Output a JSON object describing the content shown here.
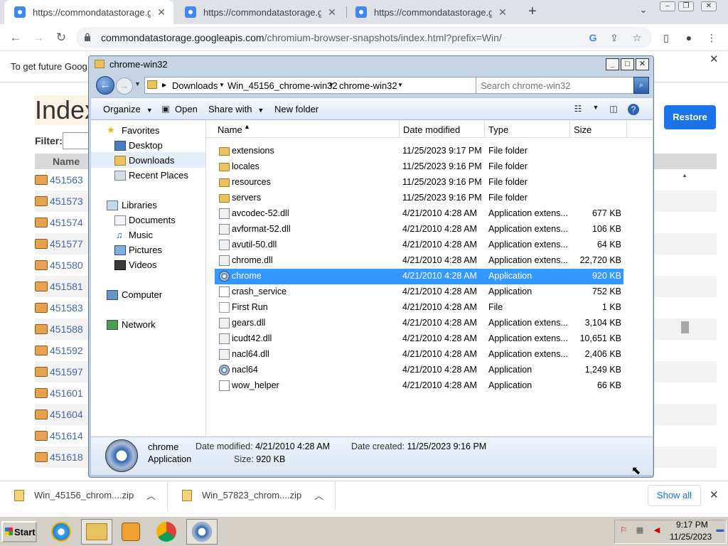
{
  "browser": {
    "tabs": [
      {
        "title": "https://commondatastorage.goo",
        "active": true
      },
      {
        "title": "https://commondatastorage.goo",
        "active": false
      },
      {
        "title": "https://commondatastorage.goo",
        "active": false
      }
    ],
    "new_tab_glyph": "+",
    "tab_close_glyph": "✕",
    "url_host": "commondatastorage.googleapis.com",
    "url_path": "/chromium-browser-snapshots/index.html?prefix=Win/"
  },
  "page": {
    "banner_text": "To get future Goog",
    "restore_label": "Restore",
    "index_title": "Index",
    "filter_label": "Filter:",
    "name_header": "Name",
    "rows": [
      "451563",
      "451573",
      "451574",
      "451577",
      "451580",
      "451581",
      "451583",
      "451588",
      "451592",
      "451597",
      "451601",
      "451604",
      "451614",
      "451618"
    ]
  },
  "explorer": {
    "title": "chrome-win32",
    "breadcrumb": [
      "Downloads",
      "Win_45156_chrome-win32",
      "chrome-win32"
    ],
    "search_placeholder": "Search chrome-win32",
    "commands": {
      "organize": "Organize",
      "open": "Open",
      "share_with": "Share with",
      "new_folder": "New folder"
    },
    "nav": {
      "favorites": "Favorites",
      "desktop": "Desktop",
      "downloads": "Downloads",
      "recent_places": "Recent Places",
      "libraries": "Libraries",
      "documents": "Documents",
      "music": "Music",
      "pictures": "Pictures",
      "videos": "Videos",
      "computer": "Computer",
      "network": "Network"
    },
    "columns": {
      "name": "Name",
      "date_modified": "Date modified",
      "type": "Type",
      "size": "Size"
    },
    "files": [
      {
        "name": "extensions",
        "date": "11/25/2023 9:17 PM",
        "type": "File folder",
        "size": "",
        "icon": "folder-icon"
      },
      {
        "name": "locales",
        "date": "11/25/2023 9:16 PM",
        "type": "File folder",
        "size": "",
        "icon": "folder-icon"
      },
      {
        "name": "resources",
        "date": "11/25/2023 9:16 PM",
        "type": "File folder",
        "size": "",
        "icon": "folder-icon"
      },
      {
        "name": "servers",
        "date": "11/25/2023 9:16 PM",
        "type": "File folder",
        "size": "",
        "icon": "folder-icon"
      },
      {
        "name": "avcodec-52.dll",
        "date": "4/21/2010 4:28 AM",
        "type": "Application extens...",
        "size": "677 KB",
        "icon": "dll-icon"
      },
      {
        "name": "avformat-52.dll",
        "date": "4/21/2010 4:28 AM",
        "type": "Application extens...",
        "size": "106 KB",
        "icon": "dll-icon"
      },
      {
        "name": "avutil-50.dll",
        "date": "4/21/2010 4:28 AM",
        "type": "Application extens...",
        "size": "64 KB",
        "icon": "dll-icon"
      },
      {
        "name": "chrome.dll",
        "date": "4/21/2010 4:28 AM",
        "type": "Application extens...",
        "size": "22,720 KB",
        "icon": "dll-icon"
      },
      {
        "name": "chrome",
        "date": "4/21/2010 4:28 AM",
        "type": "Application",
        "size": "920 KB",
        "icon": "chrome-app-icon",
        "selected": true
      },
      {
        "name": "crash_service",
        "date": "4/21/2010 4:28 AM",
        "type": "Application",
        "size": "752 KB",
        "icon": "exe-icon"
      },
      {
        "name": "First Run",
        "date": "4/21/2010 4:28 AM",
        "type": "File",
        "size": "1 KB",
        "icon": "file-icon"
      },
      {
        "name": "gears.dll",
        "date": "4/21/2010 4:28 AM",
        "type": "Application extens...",
        "size": "3,104 KB",
        "icon": "dll-icon"
      },
      {
        "name": "icudt42.dll",
        "date": "4/21/2010 4:28 AM",
        "type": "Application extens...",
        "size": "10,651 KB",
        "icon": "dll-icon"
      },
      {
        "name": "nacl64.dll",
        "date": "4/21/2010 4:28 AM",
        "type": "Application extens...",
        "size": "2,406 KB",
        "icon": "dll-icon"
      },
      {
        "name": "nacl64",
        "date": "4/21/2010 4:28 AM",
        "type": "Application",
        "size": "1,249 KB",
        "icon": "chrome-app-icon"
      },
      {
        "name": "wow_helper",
        "date": "4/21/2010 4:28 AM",
        "type": "Application",
        "size": "66 KB",
        "icon": "exe-icon"
      }
    ],
    "details": {
      "name": "chrome",
      "type": "Application",
      "date_modified_label": "Date modified:",
      "date_modified": "4/21/2010 4:28 AM",
      "date_created_label": "Date created:",
      "date_created": "11/25/2023 9:16 PM",
      "size_label": "Size:",
      "size": "920 KB"
    }
  },
  "downloads": {
    "items": [
      "Win_45156_chrom....zip",
      "Win_57823_chrom....zip"
    ],
    "show_all": "Show all"
  },
  "taskbar": {
    "start": "Start",
    "time": "9:17 PM",
    "date": "11/25/2023"
  },
  "colors": {
    "selection": "#3399ff",
    "chrome_accent": "#1a73e8",
    "link": "#4466aa"
  }
}
